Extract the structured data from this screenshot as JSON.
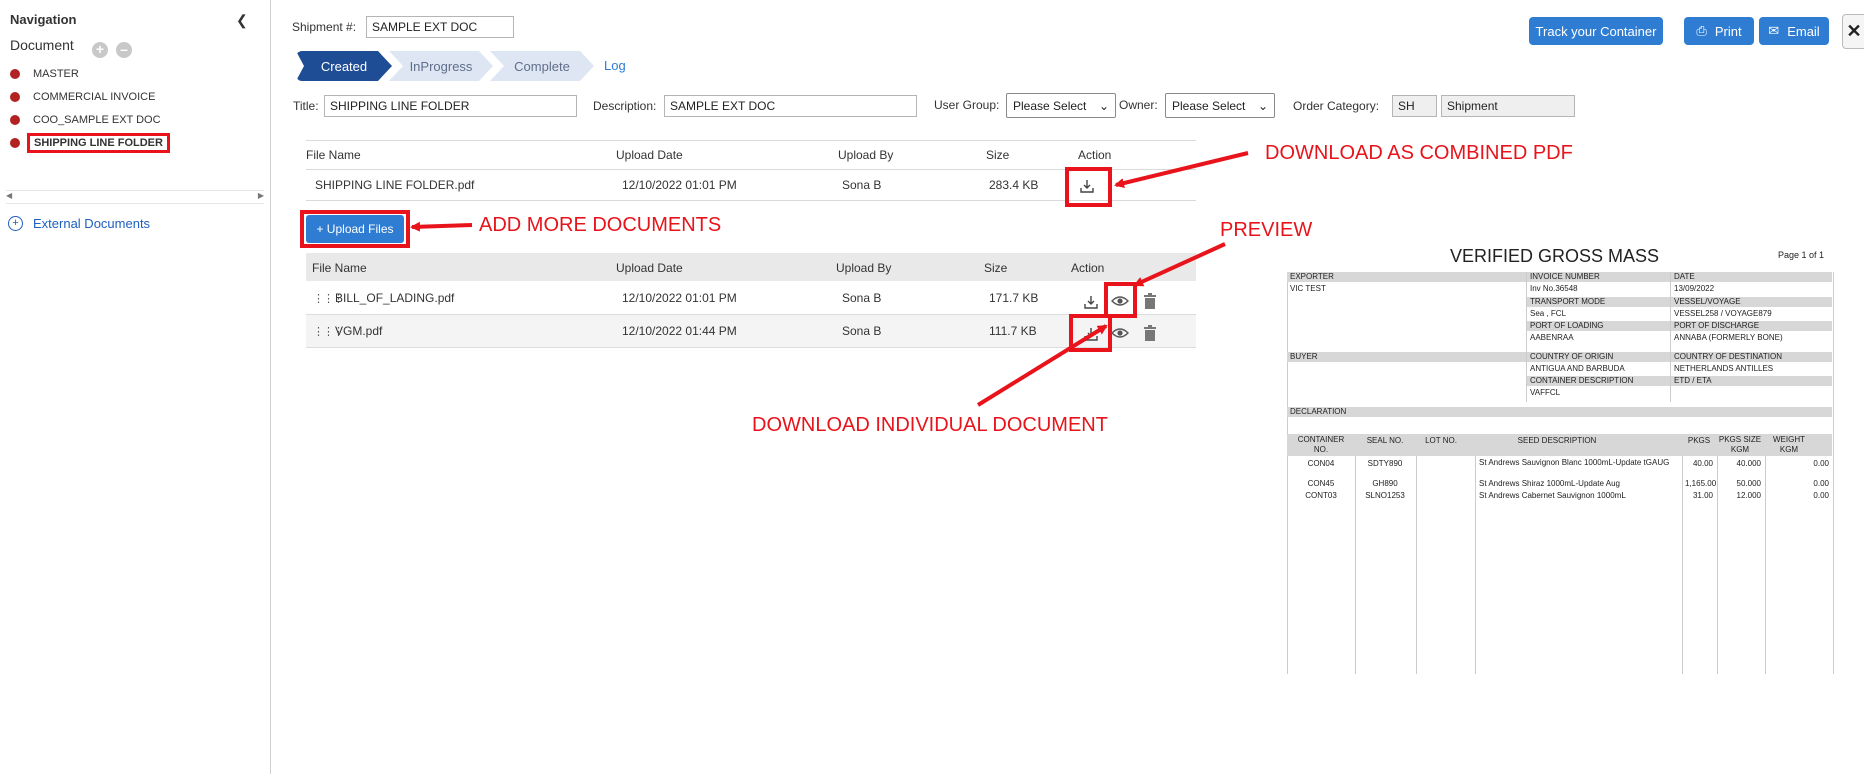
{
  "sidebar": {
    "title": "Navigation",
    "document_label": "Document",
    "items": [
      {
        "label": "MASTER"
      },
      {
        "label": "COMMERCIAL INVOICE"
      },
      {
        "label": "COO_SAMPLE EXT DOC"
      },
      {
        "label": "SHIPPING LINE FOLDER",
        "selected": true
      }
    ],
    "external_documents": "External Documents"
  },
  "header": {
    "shipment_label": "Shipment #:",
    "shipment_value": "SAMPLE EXT DOC",
    "track_button": "Track your Container",
    "print_button": "Print",
    "email_button": "Email",
    "close_icon": "close-icon"
  },
  "steps": [
    {
      "label": "Created",
      "active": true
    },
    {
      "label": "InProgress",
      "active": false
    },
    {
      "label": "Complete",
      "active": false
    }
  ],
  "log_link": "Log",
  "form": {
    "title_label": "Title:",
    "title_value": "SHIPPING LINE FOLDER",
    "description_label": "Description:",
    "description_value": "SAMPLE EXT DOC",
    "user_group_label": "User Group:",
    "user_group_value": "Please Select",
    "owner_label": "Owner:",
    "owner_value": "Please Select",
    "order_category_label": "Order Category:",
    "order_category_code": "SH",
    "order_category_name": "Shipment"
  },
  "combined_table": {
    "headers": [
      "File Name",
      "Upload Date",
      "Upload By",
      "Size",
      "Action"
    ],
    "rows": [
      {
        "file": "SHIPPING LINE FOLDER.pdf",
        "date": "12/10/2022 01:01 PM",
        "by": "Sona B",
        "size": "283.4 KB"
      }
    ]
  },
  "upload_button": "+ Upload Files",
  "docs_table": {
    "headers": [
      "File Name",
      "Upload Date",
      "Upload By",
      "Size",
      "Action"
    ],
    "rows": [
      {
        "file": "BILL_OF_LADING.pdf",
        "date": "12/10/2022 01:01 PM",
        "by": "Sona B",
        "size": "171.7 KB"
      },
      {
        "file": "VGM.pdf",
        "date": "12/10/2022 01:44 PM",
        "by": "Sona B",
        "size": "111.7 KB"
      }
    ]
  },
  "annotations": {
    "combined": "DOWNLOAD AS COMBINED PDF",
    "add_more": "ADD MORE DOCUMENTS",
    "preview": "PREVIEW",
    "individual": "DOWNLOAD INDIVIDUAL DOCUMENT"
  },
  "preview": {
    "title": "VERIFIED GROSS MASS",
    "page": "Page 1 of 1",
    "exporter_label": "EXPORTER",
    "exporter_value": "VIC TEST",
    "invoice_number_label": "INVOICE NUMBER",
    "invoice_number_value": "Inv No.36548",
    "date_label": "DATE",
    "date_value": "13/09/2022",
    "transport_mode_label": "TRANSPORT MODE",
    "transport_mode_value": "Sea , FCL",
    "vessel_label": "VESSEL/VOYAGE",
    "vessel_value": "VESSEL258 / VOYAGE879",
    "pol_label": "PORT OF LOADING",
    "pol_value": "AABENRAA",
    "pod_label": "PORT OF DISCHARGE",
    "pod_value": "ANNABA (FORMERLY BONE)",
    "buyer_label": "BUYER",
    "origin_label": "COUNTRY OF ORIGIN",
    "origin_value": "ANTIGUA AND BARBUDA",
    "destination_label": "COUNTRY OF DESTINATION",
    "destination_value": "NETHERLANDS ANTILLES",
    "container_desc_label": "CONTAINER DESCRIPTION",
    "container_desc_value": "VAFFCL",
    "etd_label": "ETD / ETA",
    "declaration_label": "DECLARATION",
    "columns": [
      "CONTAINER NO.",
      "SEAL NO.",
      "LOT NO.",
      "SEED DESCRIPTION",
      "PKGS",
      "PKGS SIZE KGM",
      "WEIGHT KGM"
    ],
    "rows": [
      {
        "container": "CON04",
        "seal": "SDTY890",
        "lot": "",
        "desc": "St Andrews  Sauvignon Blanc  1000mL-Update tGAUG",
        "pkgs": "40.00",
        "size": "40.000",
        "weight": "0.00"
      },
      {
        "container": "CON45",
        "seal": "GH890",
        "lot": "",
        "desc": "St Andrews Shiraz 1000mL-Update Aug",
        "pkgs": "1,165.00",
        "size": "50.000",
        "weight": "0.00"
      },
      {
        "container": "CONT03",
        "seal": "SLNO1253",
        "lot": "",
        "desc": "St Andrews Cabernet Sauvignon 1000mL",
        "pkgs": "31.00",
        "size": "12.000",
        "weight": "0.00"
      }
    ]
  },
  "colors": {
    "accent": "#2f7dd3",
    "step_active": "#1f4d95",
    "annotation": "#e8131b",
    "bullet": "#b22222"
  }
}
